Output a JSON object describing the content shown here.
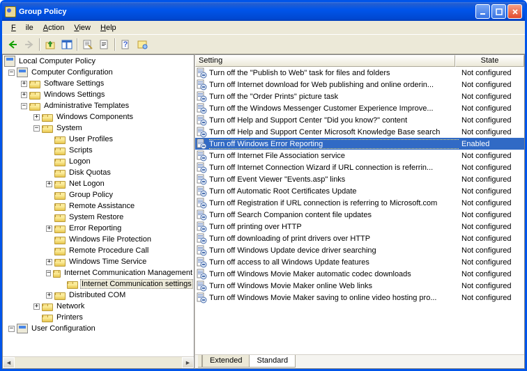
{
  "window": {
    "title": "Group Policy"
  },
  "menu": {
    "file": "File",
    "action": "Action",
    "view": "View",
    "help": "Help"
  },
  "tree": {
    "root": "Local Computer Policy",
    "comp": "Computer Configuration",
    "soft": "Software Settings",
    "wind": "Windows Settings",
    "admin": "Administrative Templates",
    "wcomp": "Windows Components",
    "system": "System",
    "usrprof": "User Profiles",
    "scripts": "Scripts",
    "logon": "Logon",
    "diskq": "Disk Quotas",
    "netlog": "Net Logon",
    "gpol": "Group Policy",
    "rassist": "Remote Assistance",
    "sysrest": "System Restore",
    "errrep": "Error Reporting",
    "wfp": "Windows File Protection",
    "rpc": "Remote Procedure Call",
    "wts": "Windows Time Service",
    "icm": "Internet Communication Management",
    "ics": "Internet Communication settings",
    "dcom": "Distributed COM",
    "net": "Network",
    "prn": "Printers",
    "user": "User Configuration"
  },
  "list": {
    "headers": {
      "setting": "Setting",
      "state": "State"
    },
    "items": [
      {
        "t": "Turn off the \"Publish to Web\" task for files and folders",
        "s": "Not configured"
      },
      {
        "t": "Turn off Internet download for Web publishing and online orderin...",
        "s": "Not configured"
      },
      {
        "t": "Turn off the \"Order Prints\" picture task",
        "s": "Not configured"
      },
      {
        "t": "Turn off the Windows Messenger Customer Experience Improve...",
        "s": "Not configured"
      },
      {
        "t": "Turn off Help and Support Center \"Did you know?\" content",
        "s": "Not configured"
      },
      {
        "t": "Turn off Help and Support Center Microsoft Knowledge Base search",
        "s": "Not configured"
      },
      {
        "t": "Turn off Windows Error Reporting",
        "s": "Enabled",
        "sel": true
      },
      {
        "t": "Turn off Internet File Association service",
        "s": "Not configured"
      },
      {
        "t": "Turn off Internet Connection Wizard if URL connection is referrin...",
        "s": "Not configured"
      },
      {
        "t": "Turn off Event Viewer \"Events.asp\" links",
        "s": "Not configured"
      },
      {
        "t": "Turn off Automatic Root Certificates Update",
        "s": "Not configured"
      },
      {
        "t": "Turn off Registration if URL connection is referring to Microsoft.com",
        "s": "Not configured"
      },
      {
        "t": "Turn off Search Companion content file updates",
        "s": "Not configured"
      },
      {
        "t": "Turn off printing over HTTP",
        "s": "Not configured"
      },
      {
        "t": "Turn off downloading of print drivers over HTTP",
        "s": "Not configured"
      },
      {
        "t": "Turn off Windows Update device driver searching",
        "s": "Not configured"
      },
      {
        "t": "Turn off access to all Windows Update features",
        "s": "Not configured"
      },
      {
        "t": "Turn off Windows Movie Maker automatic codec downloads",
        "s": "Not configured"
      },
      {
        "t": "Turn off Windows Movie Maker online Web links",
        "s": "Not configured"
      },
      {
        "t": "Turn off Windows Movie Maker saving to online video hosting pro...",
        "s": "Not configured"
      }
    ]
  },
  "tabs": {
    "ext": "Extended",
    "std": "Standard"
  }
}
